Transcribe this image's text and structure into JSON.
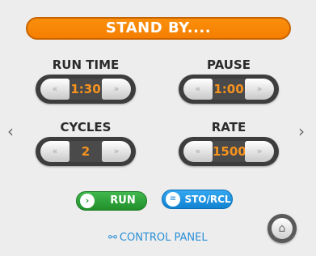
{
  "status": {
    "text": "STAND BY...."
  },
  "controls": [
    {
      "label": "RUN TIME",
      "value": "1:30",
      "dec_icon": "«",
      "inc_icon": "»"
    },
    {
      "label": "PAUSE",
      "value": "1:00",
      "dec_icon": "«",
      "inc_icon": "»"
    },
    {
      "label": "CYCLES",
      "value": "2",
      "dec_icon": "«",
      "inc_icon": "»"
    },
    {
      "label": "RATE",
      "value": "1500",
      "dec_icon": "«",
      "inc_icon": "»"
    }
  ],
  "nav": {
    "prev_icon": "‹",
    "next_icon": "›"
  },
  "actions": {
    "run": {
      "label": "RUN",
      "icon": "›",
      "color": "#2ea83a"
    },
    "sto_rcl": {
      "label": "STO/RCL",
      "icon": "≡",
      "color": "#1e95e8"
    }
  },
  "footer": {
    "control_panel_label": "CONTROL PANEL",
    "control_panel_icon": "⚯",
    "home_icon": "⌂"
  },
  "colors": {
    "accent": "#f7931e",
    "background": "#ededed",
    "link": "#2a8fd6"
  }
}
